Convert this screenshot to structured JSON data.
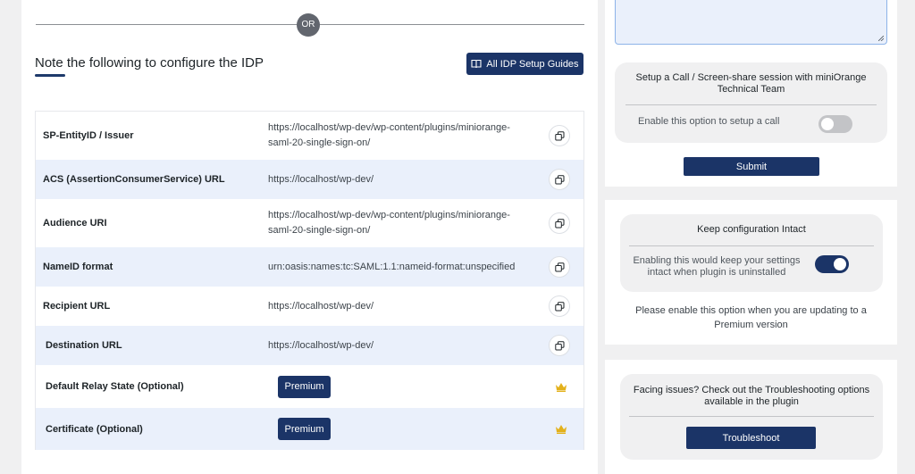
{
  "divider": {
    "or_label": "OR"
  },
  "config": {
    "title": "Note the following to configure the IDP",
    "guides_button": "All IDP Setup Guides",
    "rows": [
      {
        "label": "SP-EntityID / Issuer",
        "value": "https://localhost/wp-dev/wp-content/plugins/miniorange-saml-20-single-sign-on/",
        "action": "copy-icon"
      },
      {
        "label": "ACS (AssertionConsumerService) URL",
        "value": "https://localhost/wp-dev/",
        "action": "copy-icon"
      },
      {
        "label": "Audience URI",
        "value": "https://localhost/wp-dev/wp-content/plugins/miniorange-saml-20-single-sign-on/",
        "action": "copy-icon"
      },
      {
        "label": "NameID format",
        "value": "urn:oasis:names:tc:SAML:1.1:nameid-format:unspecified",
        "action": "copy-icon"
      },
      {
        "label": "Recipient URL",
        "value": "https://localhost/wp-dev/",
        "action": "copy-icon"
      },
      {
        "label": "Destination URL",
        "value": "https://localhost/wp-dev/",
        "action": "copy-icon"
      },
      {
        "label": "Default Relay State (Optional)",
        "button": "Premium",
        "action": "crown-icon"
      },
      {
        "label": "Certificate (Optional)",
        "button": "Premium",
        "action": "crown-icon"
      }
    ]
  },
  "support": {
    "call_title": "Setup a Call / Screen-share session with miniOrange Technical Team",
    "call_toggle_label": "Enable this option to setup a call",
    "call_toggle_on": false,
    "submit_label": "Submit"
  },
  "keep_config": {
    "title": "Keep configuration Intact",
    "toggle_label": "Enabling this would keep your settings intact when plugin is uninstalled",
    "toggle_on": true,
    "note": "Please enable this option when you are updating to a Premium version"
  },
  "troubleshoot": {
    "title": "Facing issues? Check out the Troubleshooting options available in the plugin",
    "button_label": "Troubleshoot"
  },
  "colors": {
    "primary": "#1b3467",
    "row_alt": "#eaf0fb",
    "crown": "#e3b11b",
    "toggle_off": "#c3c4c7"
  }
}
